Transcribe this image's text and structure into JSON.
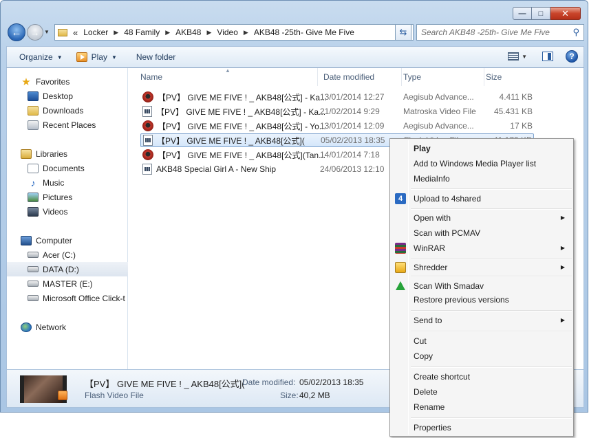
{
  "window": {
    "caption_buttons": {
      "minimize": "—",
      "maximize": "□",
      "close": "✕"
    }
  },
  "address": {
    "overflow": "«",
    "crumbs": [
      "Locker",
      "48 Family",
      "AKB48",
      "Video",
      "AKB48 -25th- Give Me Five"
    ],
    "search_placeholder": "Search AKB48 -25th- Give Me Five"
  },
  "toolbar": {
    "organize": "Organize",
    "play": "Play",
    "new_folder": "New folder"
  },
  "nav": {
    "favorites": {
      "label": "Favorites",
      "items": [
        "Desktop",
        "Downloads",
        "Recent Places"
      ]
    },
    "libraries": {
      "label": "Libraries",
      "items": [
        "Documents",
        "Music",
        "Pictures",
        "Videos"
      ]
    },
    "computer": {
      "label": "Computer",
      "items": [
        "Acer (C:)",
        "DATA (D:)",
        "MASTER (E:)",
        "Microsoft Office Click-t"
      ]
    },
    "network": {
      "label": "Network"
    }
  },
  "columns": {
    "name": "Name",
    "date": "Date modified",
    "type": "Type",
    "size": "Size"
  },
  "files": [
    {
      "name": "【PV】 GIVE ME FIVE ! _ AKB48[公式] - Ka...",
      "date": "13/01/2014 12:27",
      "type": "Aegisub Advance...",
      "size": "4.411 KB",
      "icon": "aegisub-icon"
    },
    {
      "name": "【PV】 GIVE ME FIVE ! _ AKB48[公式] - Ka...",
      "date": "21/02/2014 9:29",
      "type": "Matroska Video File",
      "size": "45.431 KB",
      "icon": "video-file-icon"
    },
    {
      "name": "【PV】 GIVE ME FIVE ! _ AKB48[公式] - Yo...",
      "date": "13/01/2014 12:09",
      "type": "Aegisub Advance...",
      "size": "17 KB",
      "icon": "aegisub-icon"
    },
    {
      "name": "【PV】 GIVE ME FIVE ! _ AKB48[公式](",
      "date": "05/02/2013 18:35",
      "type": "Flash Video File",
      "size": "41.173 KB",
      "icon": "video-file-icon",
      "selected": true
    },
    {
      "name": "【PV】 GIVE ME FIVE ! _ AKB48[公式](Tan...",
      "date": "14/01/2014 7:18",
      "type": "",
      "size": "",
      "icon": "aegisub-icon"
    },
    {
      "name": "AKB48 Special Girl A - New Ship",
      "date": "24/06/2013 12:10",
      "type": "",
      "size": "",
      "icon": "video-file-icon"
    }
  ],
  "details": {
    "name": "【PV】 GIVE ME FIVE ! _ AKB48[公式](",
    "type": "Flash Video File",
    "date_label": "Date modified:",
    "date_value": "05/02/2013 18:35",
    "size_label": "Size:",
    "size_value": "40,2 MB"
  },
  "context_menu": {
    "items": [
      {
        "label": "Play",
        "bold": true
      },
      {
        "label": "Add to Windows Media Player list"
      },
      {
        "label": "MediaInfo"
      },
      {
        "label": "Upload to 4shared",
        "icon": "4shared-icon"
      },
      {
        "label": "Open with",
        "submenu": true
      },
      {
        "label": "Scan with PCMAV"
      },
      {
        "label": "WinRAR",
        "submenu": true,
        "icon": "winrar-icon"
      },
      {
        "label": "Shredder",
        "submenu": true,
        "icon": "shredder-icon"
      },
      {
        "label": "Scan With Smadav",
        "icon": "smadav-icon"
      },
      {
        "label": "Restore previous versions"
      },
      {
        "label": "Send to",
        "submenu": true
      },
      {
        "label": "Cut"
      },
      {
        "label": "Copy"
      },
      {
        "label": "Create shortcut"
      },
      {
        "label": "Delete"
      },
      {
        "label": "Rename"
      },
      {
        "label": "Properties"
      }
    ]
  }
}
